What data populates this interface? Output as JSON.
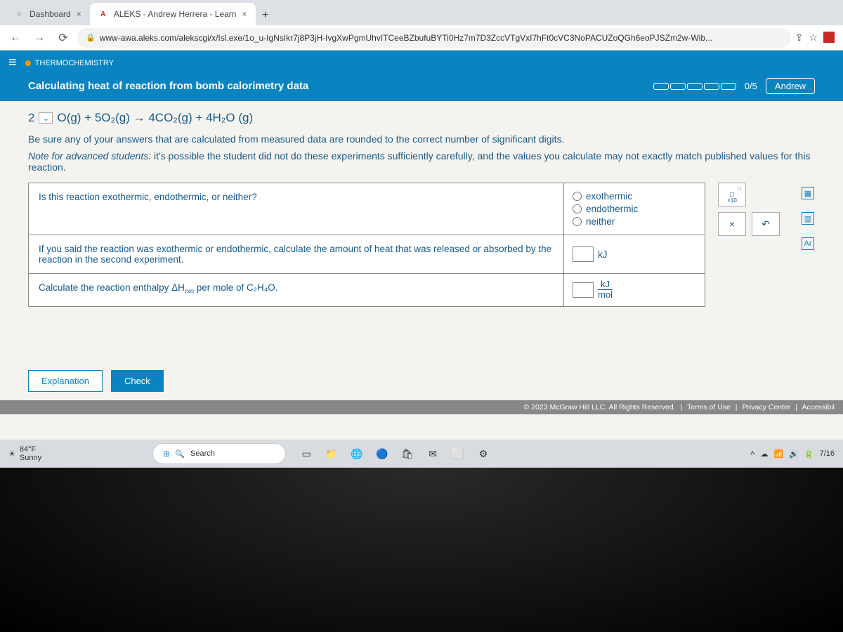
{
  "tabs": [
    {
      "title": "Dashboard",
      "favicon": "○"
    },
    {
      "title": "ALEKS - Andrew Herrera - Learn",
      "favicon": "A"
    }
  ],
  "url": "www-awa.aleks.com/alekscgi/x/Isl.exe/1o_u-IgNsIkr7j8P3jH-IvgXwPgmUhvITCeeBZbufuBYTi0Hz7m7D3ZccVTgVxI7hFt0cVC3NoPACUZoQGh6eoPJSZm2w-Wib...",
  "topic_category": "THERMOCHEMISTRY",
  "topic_title": "Calculating heat of reaction from bomb calorimetry data",
  "progress": "0/5",
  "user_name": "Andrew",
  "equation": {
    "left_num": "2",
    "rest": "O(g) + 5O₂(g) → 4CO₂(g) + 4H₂O (g)"
  },
  "instruction1": "Be sure any of your answers that are calculated from measured data are rounded to the correct number of significant digits.",
  "instruction2_prefix": "Note for advanced students:",
  "instruction2_rest": " it's possible the student did not do these experiments sufficiently carefully, and the values you calculate may not exactly match published values for this reaction.",
  "questions": {
    "q1": "Is this reaction exothermic, endothermic, or neither?",
    "q1_opts": [
      "exothermic",
      "endothermic",
      "neither"
    ],
    "q2": "If you said the reaction was exothermic or endothermic, calculate the amount of heat that was released or absorbed by the reaction in the second experiment.",
    "q2_unit": "kJ",
    "q3_prefix": "Calculate the reaction enthalpy ΔH",
    "q3_sub": "rxn",
    "q3_suffix": " per mole of C₂H₄O.",
    "q3_unit_top": "kJ",
    "q3_unit_bot": "mol"
  },
  "palette": {
    "sci": "×10",
    "clear": "×",
    "undo": "↶"
  },
  "buttons": {
    "explain": "Explanation",
    "check": "Check"
  },
  "footer": {
    "copyright": "© 2023 McGraw Hill LLC. All Rights Reserved.",
    "terms": "Terms of Use",
    "privacy": "Privacy Center",
    "access": "Accessibil"
  },
  "taskbar": {
    "temp": "84°F",
    "cond": "Sunny",
    "search_placeholder": "Search",
    "date": "7/16"
  }
}
